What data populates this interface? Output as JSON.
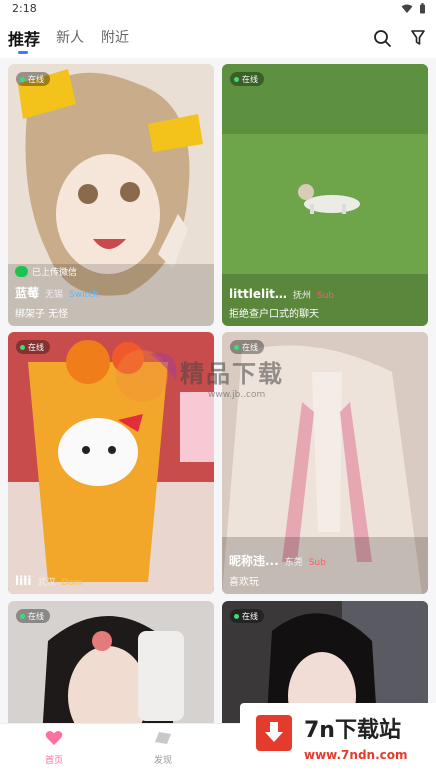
{
  "status_bar": {
    "time": "2:18"
  },
  "top_nav": {
    "tabs": [
      {
        "label": "推荐",
        "active": true
      },
      {
        "label": "新人",
        "active": false
      },
      {
        "label": "附近",
        "active": false
      }
    ],
    "icons": [
      "search-icon",
      "filter-icon"
    ]
  },
  "feed": {
    "cards": [
      {
        "online": "在线",
        "wechat_note": "已上传微信",
        "nickname": "蓝莓",
        "city": "无锡",
        "tag": "Switch",
        "bio": "绑架子 无怪"
      },
      {
        "online": "在线",
        "nickname": "littlelit...",
        "city": "抚州",
        "tag": "Sub",
        "bio": "拒绝查户口式的聊天"
      },
      {
        "online": "在线",
        "nickname": "lili",
        "city": "武汉",
        "tag": "Dom",
        "bio": ""
      },
      {
        "online": "在线",
        "nickname": "昵称违...",
        "city": "东莞",
        "tag": "Sub",
        "bio": "喜欢玩"
      },
      {
        "online": "在线"
      },
      {
        "online": "在线"
      }
    ]
  },
  "watermark": {
    "title": "精品下载",
    "url": "www.jb..com"
  },
  "bottom_nav": {
    "items": [
      {
        "label": "首页",
        "active": true,
        "icon": "home-icon"
      },
      {
        "label": "发现",
        "active": false,
        "icon": "discover-icon"
      }
    ]
  },
  "site_banner": {
    "name": "7n下载站",
    "url": "www.7ndn.com"
  },
  "colors": {
    "accent_blue": "#3b7cff",
    "online_green": "#3ddc74",
    "sub_tag": "#ff5b6a",
    "dom_tag": "#f6c343",
    "switch_tag": "#5ab8ff",
    "home_active": "#ff6fa0"
  }
}
